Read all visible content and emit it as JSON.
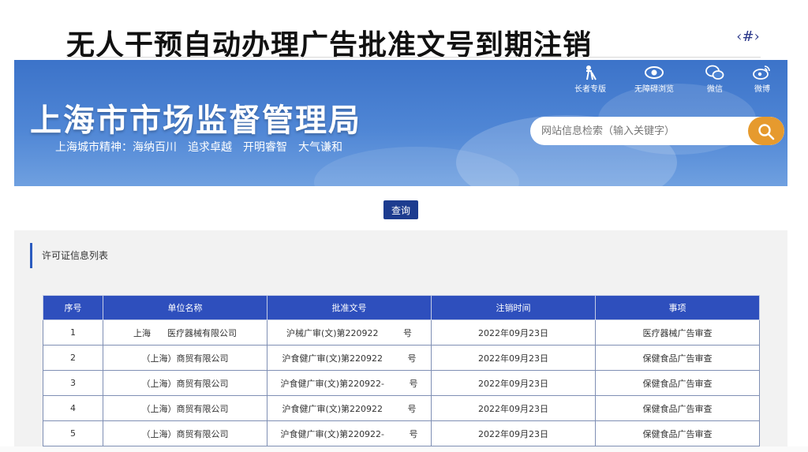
{
  "slide": {
    "title": "无人干预自动办理广告批准文号到期注销",
    "logo_text": "‹#›"
  },
  "header": {
    "site_name": "上海市市场监督管理局",
    "spirit_prefix": "上海城市精神：",
    "spirit_items": [
      "海纳百川",
      "追求卓越",
      "开明睿智",
      "大气谦和"
    ],
    "tools": [
      {
        "label": "长者专版",
        "icon": "elder-icon"
      },
      {
        "label": "无障碍浏览",
        "icon": "eye-icon"
      },
      {
        "label": "微信",
        "icon": "wechat-icon"
      },
      {
        "label": "微博",
        "icon": "weibo-icon"
      }
    ],
    "search_placeholder": "网站信息检索（输入关键字）"
  },
  "query": {
    "button_label": "查询"
  },
  "section": {
    "title": "许可证信息列表"
  },
  "table": {
    "columns": [
      "序号",
      "单位名称",
      "批准文号",
      "注销时间",
      "事项"
    ],
    "rows": [
      [
        "1",
        "上海      医疗器械有限公司",
        "沪械广审(文)第220922         号",
        "2022年09月23日",
        "医疗器械广告审查"
      ],
      [
        "2",
        "（上海）商贸有限公司",
        "沪食健广审(文)第220922         号",
        "2022年09月23日",
        "保健食品广告审查"
      ],
      [
        "3",
        "（上海）商贸有限公司",
        "沪食健广审(文)第220922-         号",
        "2022年09月23日",
        "保健食品广告审查"
      ],
      [
        "4",
        "（上海）商贸有限公司",
        "沪食健广审(文)第220922         号",
        "2022年09月23日",
        "保健食品广告审查"
      ],
      [
        "5",
        "（上海）商贸有限公司",
        "沪食健广审(文)第220922-         号",
        "2022年09月23日",
        "保健食品广告审查"
      ]
    ]
  },
  "colors": {
    "banner": "#3c73c9",
    "table_header": "#2e4fbd",
    "query_button": "#1d3c8f",
    "search_button": "#e69a2e"
  }
}
